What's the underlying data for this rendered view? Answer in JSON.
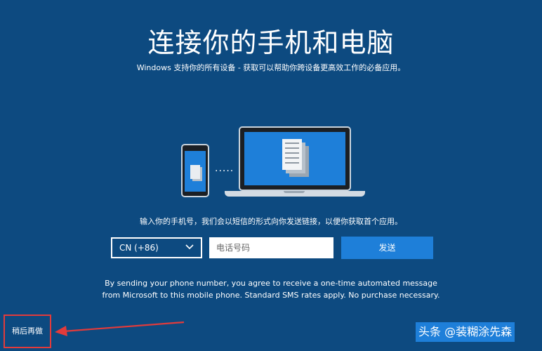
{
  "page": {
    "title": "连接你的手机和电脑",
    "subtitle": "Windows 支持你的所有设备 - 获取可以帮助你跨设备更高效工作的必备应用。",
    "instruction": "输入你的手机号，我们会以短信的形式向你发送链接，以便你获取首个应用。",
    "disclaimer_line1": "By sending your phone number, you agree to receive a one-time automated message",
    "disclaimer_line2": "from Microsoft to this mobile phone. Standard SMS rates apply. No purchase necessary."
  },
  "illustration": {
    "dots": "·····",
    "phone_icon": "smartphone-icon",
    "laptop_icon": "laptop-icon",
    "document_icon": "document-icon"
  },
  "form": {
    "country_code": "CN (+86)",
    "phone_placeholder": "电话号码",
    "send_label": "发送"
  },
  "footer": {
    "later_label": "稍后再做"
  },
  "overlay": {
    "watermark": "头条 @装糊涂先森"
  },
  "colors": {
    "background": "#0d4a80",
    "accent": "#1e7fd9",
    "annotation": "#e23b3b"
  }
}
